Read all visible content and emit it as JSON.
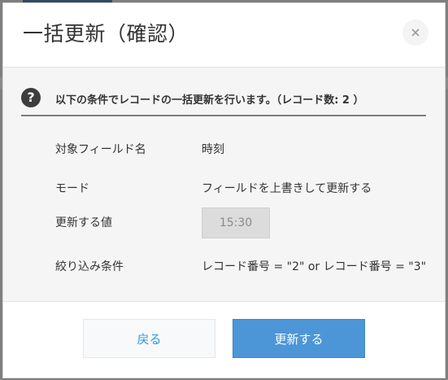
{
  "dialog": {
    "title": "一括更新（確認）",
    "close_icon": "close-icon",
    "message": "以下の条件でレコードの一括更新を行います。（レコード数: 2 ）",
    "message_icon": "question-icon",
    "fields": {
      "target_field": {
        "label": "対象フィールド名",
        "value": "時刻"
      },
      "mode": {
        "label": "モード",
        "value": "フィールドを上書きして更新する"
      },
      "update_value": {
        "label": "更新する値",
        "value": "15:30"
      },
      "filter": {
        "label": "絞り込み条件",
        "value": "レコード番号 = \"2\" or レコード番号 = \"3\""
      }
    },
    "buttons": {
      "back": "戻る",
      "update": "更新する"
    }
  },
  "colors": {
    "overlay": "#7f7f7f",
    "accent": "#4c96d8",
    "link": "#3498db"
  }
}
